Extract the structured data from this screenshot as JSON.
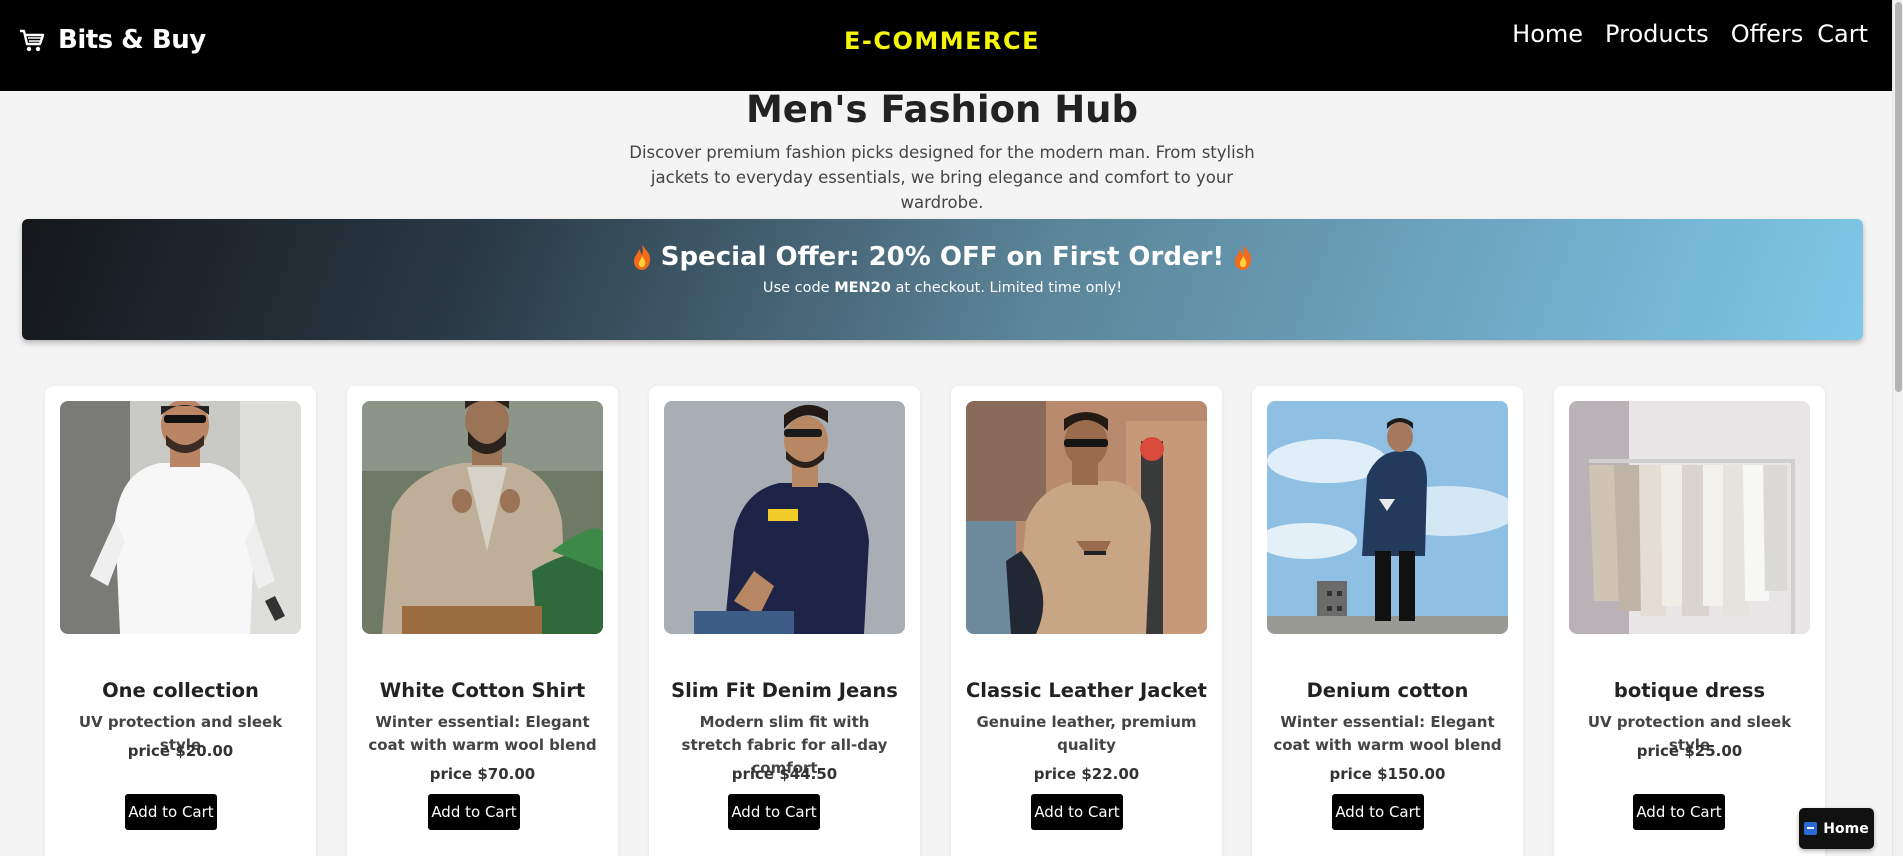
{
  "header": {
    "brand_name": "Bits & Buy",
    "center_title": "E-COMMERCE",
    "nav": [
      "Home",
      "Products",
      "Offers",
      "Cart"
    ]
  },
  "hero": {
    "title": "Men's Fashion Hub",
    "description": "Discover premium fashion picks designed for the modern man. From stylish jackets to everyday essentials, we bring elegance and comfort to your wardrobe."
  },
  "banner": {
    "title": "Special Offer: 20% OFF on First Order!",
    "sub_before": "Use code ",
    "code": "MEN20",
    "sub_after": " at checkout. Limited time only!"
  },
  "products": [
    {
      "title": "One collection",
      "desc": "UV protection and sleek style",
      "price": "price $20.00",
      "button": "Add to Cart"
    },
    {
      "title": "White Cotton Shirt",
      "desc": "Winter essential: Elegant coat with warm wool blend",
      "price": "price $70.00",
      "button": "Add to Cart"
    },
    {
      "title": "Slim Fit Denim Jeans",
      "desc": "Modern slim fit with stretch fabric for all-day comfort",
      "price": "price $44.50",
      "button": "Add to Cart"
    },
    {
      "title": "Classic Leather Jacket",
      "desc": "Genuine leather, premium quality",
      "price": "price $22.00",
      "button": "Add to Cart"
    },
    {
      "title": "Denium cotton",
      "desc": "Winter essential: Elegant coat with warm wool blend",
      "price": "price $150.00",
      "button": "Add to Cart"
    },
    {
      "title": "botique dress",
      "desc": "UV protection and sleek style",
      "price": "price $25.00",
      "button": "Add to Cart"
    }
  ],
  "floating_button": {
    "label": "Home"
  },
  "colors": {
    "header_bg": "#000000",
    "accent_yellow": "#f5f50a",
    "button_bg": "#000000"
  }
}
